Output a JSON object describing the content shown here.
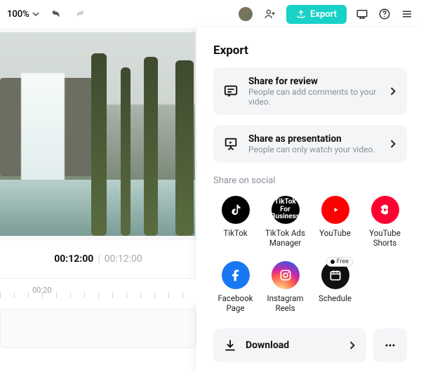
{
  "topbar": {
    "zoom": "100%",
    "export_label": "Export"
  },
  "timeline": {
    "current": "00:12:00",
    "duration": "00:12:00",
    "ruler_mark": "00:20"
  },
  "panel": {
    "title": "Export",
    "review": {
      "title": "Share for review",
      "subtitle": "People can add comments to your video."
    },
    "presentation": {
      "title": "Share as presentation",
      "subtitle": "People can only watch your video."
    },
    "social_label": "Share on social",
    "socials": {
      "tiktok": "TikTok",
      "tiktok_ads": "TikTok Ads Manager",
      "tiktok_ads_icon": "TikTok For Business",
      "youtube": "YouTube",
      "shorts": "YouTube Shorts",
      "facebook": "Facebook Page",
      "instagram": "Instagram Reels",
      "schedule": "Schedule",
      "schedule_badge": "Free"
    },
    "download": "Download"
  }
}
